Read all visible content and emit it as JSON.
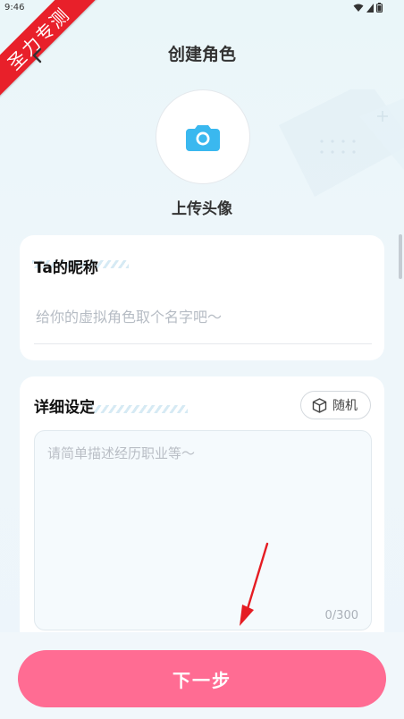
{
  "status_bar": {
    "time": "9:46"
  },
  "watermark": {
    "text": "圣力专测"
  },
  "header": {
    "title": "创建角色"
  },
  "avatar": {
    "upload_label": "上传头像"
  },
  "nickname": {
    "title": "Ta的昵称",
    "placeholder": "给你的虚拟角色取个名字吧～",
    "value": ""
  },
  "detail": {
    "title": "详细设定",
    "random_label": "随机",
    "placeholder": "请简单描述经历职业等～",
    "value": "",
    "counter": "0/300"
  },
  "footer": {
    "next_label": "下一步"
  },
  "colors": {
    "accent": "#ff6c93",
    "camera": "#3ab8ef",
    "ribbon": "#e8202a"
  },
  "icons": [
    "back-arrow-icon",
    "camera-icon",
    "dice-icon",
    "wifi-icon",
    "battery-icon"
  ]
}
